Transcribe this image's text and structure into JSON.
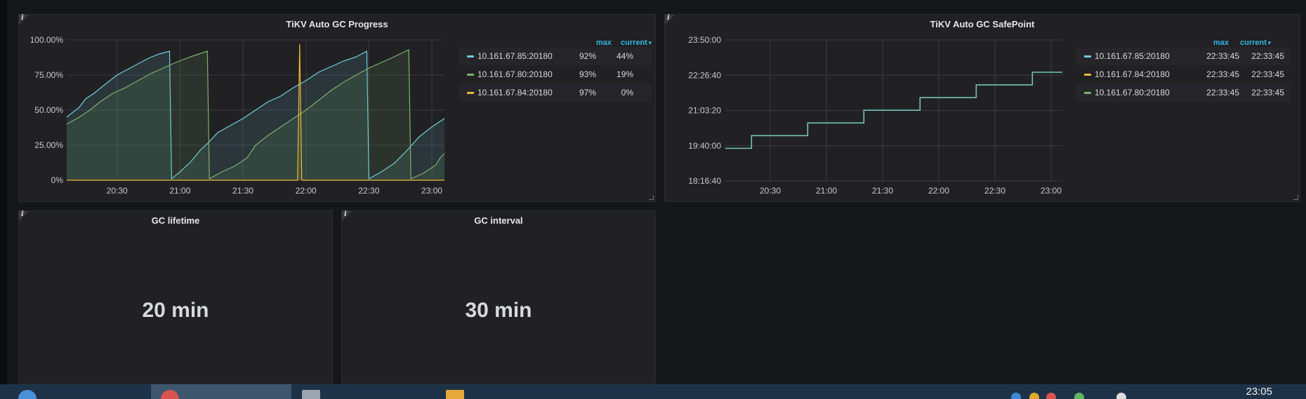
{
  "colors": {
    "blue": "#6ed0e0",
    "green": "#7eb26d",
    "yellow": "#eab839",
    "accent": "#33b5e5",
    "panel_bg": "#212124",
    "taskbar_bg": "#1e3247"
  },
  "panels": {
    "gc_progress": {
      "title": "TiKV Auto GC Progress",
      "legend_headers": {
        "max": "max",
        "current": "current"
      },
      "legend": [
        {
          "name": "10.161.67.85:20180",
          "max": "92%",
          "current": "44%",
          "color": "#6ed0e0"
        },
        {
          "name": "10.161.67.80:20180",
          "max": "93%",
          "current": "19%",
          "color": "#7eb26d"
        },
        {
          "name": "10.161.67.84:20180",
          "max": "97%",
          "current": "0%",
          "color": "#eab839"
        }
      ]
    },
    "gc_safepoint": {
      "title": "TiKV Auto GC SafePoint",
      "legend_headers": {
        "max": "max",
        "current": "current"
      },
      "legend": [
        {
          "name": "10.161.67.85:20180",
          "max": "22:33:45",
          "current": "22:33:45",
          "color": "#6ed0e0"
        },
        {
          "name": "10.161.67.84:20180",
          "max": "22:33:45",
          "current": "22:33:45",
          "color": "#eab839"
        },
        {
          "name": "10.161.67.80:20180",
          "max": "22:33:45",
          "current": "22:33:45",
          "color": "#7eb26d"
        }
      ]
    },
    "gc_lifetime": {
      "title": "GC lifetime",
      "value": "20 min"
    },
    "gc_interval": {
      "title": "GC interval",
      "value": "30 min"
    }
  },
  "chart_data": [
    {
      "type": "area",
      "title": "TiKV Auto GC Progress",
      "x_unit": "time (HH:MM)",
      "x_ticks": [
        "20:30",
        "21:00",
        "21:30",
        "22:00",
        "22:30",
        "23:00"
      ],
      "y_ticks": [
        "0%",
        "25.00%",
        "50.00%",
        "75.00%",
        "100.00%"
      ],
      "xlim": [
        "20:06",
        "23:06"
      ],
      "ylim": [
        0,
        100
      ],
      "grid": true,
      "legend_position": "right",
      "series": [
        {
          "name": "10.161.67.85:20180",
          "color": "#6ed0e0",
          "points": [
            [
              "20:06",
              45
            ],
            [
              "20:12",
              52
            ],
            [
              "20:15",
              58
            ],
            [
              "20:19",
              62
            ],
            [
              "20:24",
              68
            ],
            [
              "20:30",
              75
            ],
            [
              "20:35",
              79
            ],
            [
              "20:40",
              83
            ],
            [
              "20:45",
              87
            ],
            [
              "20:50",
              90
            ],
            [
              "20:55",
              92
            ],
            [
              "20:56",
              1
            ],
            [
              "21:00",
              6
            ],
            [
              "21:05",
              13
            ],
            [
              "21:10",
              22
            ],
            [
              "21:13",
              26
            ],
            [
              "21:18",
              34
            ],
            [
              "21:24",
              39
            ],
            [
              "21:30",
              44
            ],
            [
              "21:36",
              50
            ],
            [
              "21:42",
              56
            ],
            [
              "21:48",
              60
            ],
            [
              "21:54",
              66
            ],
            [
              "22:00",
              71
            ],
            [
              "22:06",
              77
            ],
            [
              "22:12",
              81
            ],
            [
              "22:18",
              85
            ],
            [
              "22:24",
              88
            ],
            [
              "22:29",
              92
            ],
            [
              "22:30",
              1
            ],
            [
              "22:36",
              6
            ],
            [
              "22:42",
              12
            ],
            [
              "22:48",
              21
            ],
            [
              "22:54",
              31
            ],
            [
              "23:00",
              38
            ],
            [
              "23:06",
              44
            ]
          ]
        },
        {
          "name": "10.161.67.80:20180",
          "color": "#7eb26d",
          "points": [
            [
              "20:06",
              40
            ],
            [
              "20:12",
              45
            ],
            [
              "20:17",
              50
            ],
            [
              "20:22",
              56
            ],
            [
              "20:28",
              62
            ],
            [
              "20:34",
              66
            ],
            [
              "20:40",
              71
            ],
            [
              "20:46",
              76
            ],
            [
              "20:52",
              80
            ],
            [
              "20:58",
              84
            ],
            [
              "21:05",
              88
            ],
            [
              "21:13",
              92
            ],
            [
              "21:14",
              1
            ],
            [
              "21:20",
              6
            ],
            [
              "21:26",
              10
            ],
            [
              "21:32",
              16
            ],
            [
              "21:36",
              25
            ],
            [
              "21:42",
              32
            ],
            [
              "21:48",
              38
            ],
            [
              "21:54",
              44
            ],
            [
              "22:00",
              50
            ],
            [
              "22:06",
              57
            ],
            [
              "22:12",
              64
            ],
            [
              "22:18",
              70
            ],
            [
              "22:24",
              75
            ],
            [
              "22:30",
              80
            ],
            [
              "22:36",
              84
            ],
            [
              "22:42",
              88
            ],
            [
              "22:49",
              93
            ],
            [
              "22:50",
              1
            ],
            [
              "22:56",
              5
            ],
            [
              "23:02",
              11
            ],
            [
              "23:04",
              16
            ],
            [
              "23:06",
              19
            ]
          ]
        },
        {
          "name": "10.161.67.84:20180",
          "color": "#eab839",
          "points": [
            [
              "20:06",
              0
            ],
            [
              "21:56",
              0
            ],
            [
              "21:57",
              97
            ],
            [
              "21:58",
              0
            ],
            [
              "23:06",
              0
            ]
          ]
        }
      ]
    },
    {
      "type": "line",
      "title": "TiKV Auto GC SafePoint",
      "x_unit": "time (HH:MM)",
      "x_ticks": [
        "20:30",
        "21:00",
        "21:30",
        "22:00",
        "22:30",
        "23:00"
      ],
      "y_ticks": [
        "18:16:40",
        "19:40:00",
        "21:03:20",
        "22:26:40",
        "23:50:00"
      ],
      "xlim": [
        "20:06",
        "23:06"
      ],
      "ylim": [
        "18:16:40",
        "23:50:00"
      ],
      "grid": true,
      "legend_position": "right",
      "series_shared_points": [
        [
          "20:06",
          "19:33:45"
        ],
        [
          "20:20",
          "19:33:45"
        ],
        [
          "20:20",
          "20:03:45"
        ],
        [
          "20:50",
          "20:03:45"
        ],
        [
          "20:50",
          "20:33:45"
        ],
        [
          "21:20",
          "20:33:45"
        ],
        [
          "21:20",
          "21:03:45"
        ],
        [
          "21:50",
          "21:03:45"
        ],
        [
          "21:50",
          "21:33:45"
        ],
        [
          "22:20",
          "21:33:45"
        ],
        [
          "22:20",
          "22:03:45"
        ],
        [
          "22:50",
          "22:03:45"
        ],
        [
          "22:50",
          "22:33:45"
        ],
        [
          "23:06",
          "22:33:45"
        ]
      ]
    }
  ]
}
